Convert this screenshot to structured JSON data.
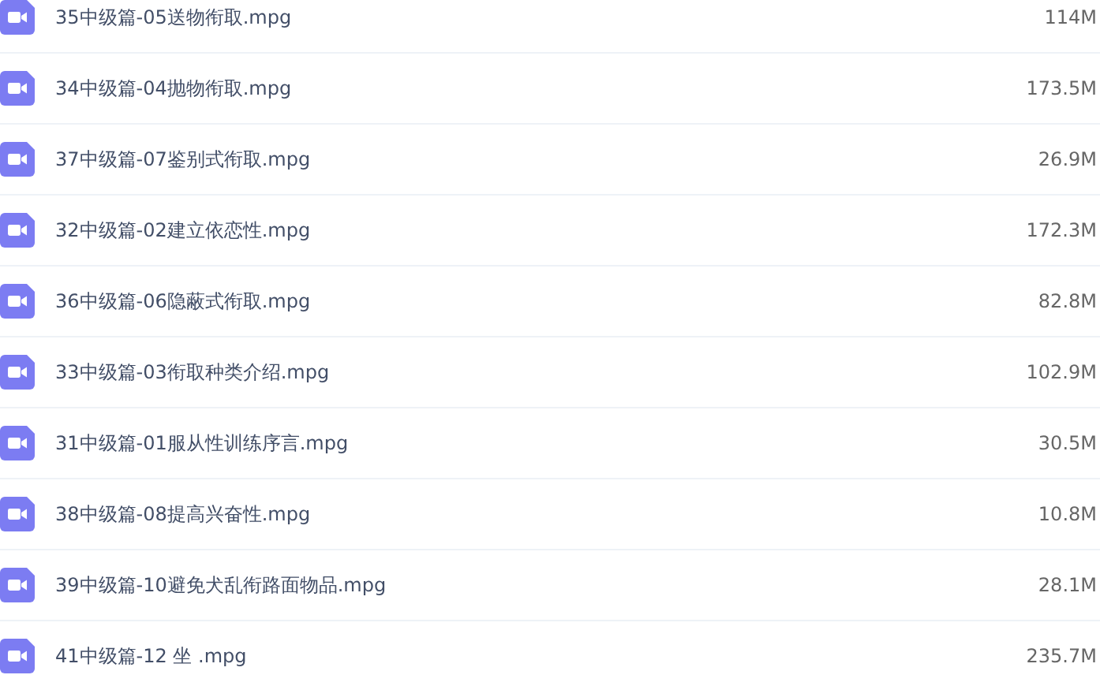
{
  "files": [
    {
      "name": "35中级篇-05送物衔取.mpg",
      "size": "114M"
    },
    {
      "name": "34中级篇-04抛物衔取.mpg",
      "size": "173.5M"
    },
    {
      "name": "37中级篇-07鉴别式衔取.mpg",
      "size": "26.9M"
    },
    {
      "name": "32中级篇-02建立依恋性.mpg",
      "size": "172.3M"
    },
    {
      "name": "36中级篇-06隐蔽式衔取.mpg",
      "size": "82.8M"
    },
    {
      "name": "33中级篇-03衔取种类介绍.mpg",
      "size": "102.9M"
    },
    {
      "name": "31中级篇-01服从性训练序言.mpg",
      "size": "30.5M"
    },
    {
      "name": "38中级篇-08提高兴奋性.mpg",
      "size": "10.8M"
    },
    {
      "name": "39中级篇-10避免犬乱衔路面物品.mpg",
      "size": "28.1M"
    },
    {
      "name": "41中级篇-12 坐 .mpg",
      "size": "235.7M"
    }
  ]
}
